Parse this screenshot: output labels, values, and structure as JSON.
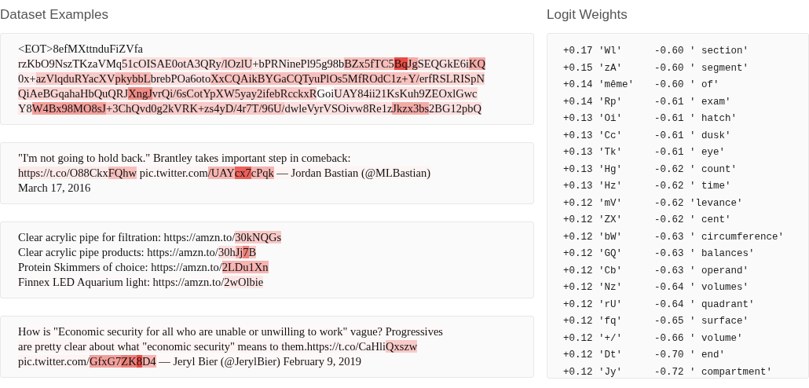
{
  "dataset_examples": {
    "title": "Dataset Examples",
    "examples": [
      {
        "lines": [
          [
            {
              "text": "<EOT>8efMXttnduFiZVfa"
            }
          ],
          [
            {
              "text": "rzKbO9NszTKzaVMq",
              "color": "#fef4f4"
            },
            {
              "text": "51cOISAE0otA3QRy",
              "color": "#fbdfde"
            },
            {
              "text": "/lOzlU",
              "color": "#f9d1cf"
            },
            {
              "text": "+bPRNinePl95g98b",
              "color": "#fceae9"
            },
            {
              "text": "BZx5fTC5",
              "color": "#f7c0bd"
            },
            {
              "text": "Bq",
              "color": "#e84c44"
            },
            {
              "text": "Jg",
              "color": "#f4aba7"
            },
            {
              "text": "SEQGkE6i",
              "color": "#fbdfde"
            },
            {
              "text": "KQ",
              "color": "#f4aba7"
            }
          ],
          [
            {
              "text": "0x+",
              "color": "#fceae9"
            },
            {
              "text": "azVlqduRYacXV",
              "color": "#f8cac8"
            },
            {
              "text": "pkybbL",
              "color": "#f6b5b2"
            },
            {
              "text": "brebPOa6oto",
              "color": "#fbdfde"
            },
            {
              "text": "XxCQAikBYGaCQTyuPlOs5MfROdC1z+Y/",
              "color": "#f7c0bd"
            },
            {
              "text": "erfRSLRISpN",
              "color": "#fad5d3"
            }
          ],
          [
            {
              "text": "QiAeBGqahaHbQuQRJ",
              "color": "#fad5d3"
            },
            {
              "text": "XngJ",
              "color": "#f08b86"
            },
            {
              "text": "vrQi/6sCotYpXW5yay2ifebRcckxR",
              "color": "#f8cac8"
            },
            {
              "text": "Goi",
              "color": "#fefbfb"
            },
            {
              "text": "UAY84ii21KsKuh9ZEOxlGwc",
              "color": "#fbdfde"
            }
          ],
          [
            {
              "text": "Y8",
              "color": "#fceae9"
            },
            {
              "text": "W4Bx98MO8sJ",
              "color": "#f3a09c"
            },
            {
              "text": "+3ChQvd0g2kVRK+zs4yD/4r7T/96U/",
              "color": "#f8cac8"
            },
            {
              "text": "dwleVyrVSOivw8Re1z",
              "color": "#fbdfde"
            },
            {
              "text": "Jkzx3bs",
              "color": "#f4aba7"
            },
            {
              "text": "2BG12pbQ",
              "color": "#fbdfde"
            }
          ]
        ]
      },
      {
        "lines": [
          [
            {
              "text": "\"I'm not going to hold back.\" Brantley takes important step in comeback:",
              "color": "#fef9f8"
            }
          ],
          [
            {
              "text": "https://t.co/O88Ckx",
              "color": "#fceae9"
            },
            {
              "text": "FQhw",
              "color": "#f7c0bd"
            },
            {
              "text": " pic.twitter.com",
              "color": "#fef4f4"
            },
            {
              "text": "/UAY",
              "color": "#f6b5b2"
            },
            {
              "text": "cx7",
              "color": "#eb615a"
            },
            {
              "text": "cPqk",
              "color": "#f6b5b2"
            },
            {
              "text": " — Jordan Bastian (@MLBastian)",
              "color": "#fef4f4"
            }
          ],
          [
            {
              "text": "March 17, 2016"
            }
          ]
        ]
      },
      {
        "lines": [
          [
            {
              "text": "Clear acrylic pipe for filtration: https://amzn.to/"
            },
            {
              "text": "30kNQGs",
              "color": "#f8cac8"
            }
          ],
          [
            {
              "text": "Clear acrylic pipe products: https://amzn.to/"
            },
            {
              "text": "30h",
              "color": "#fbdfde"
            },
            {
              "text": "Jj",
              "color": "#f6b5b2"
            },
            {
              "text": "7",
              "color": "#ef817b"
            },
            {
              "text": "B",
              "color": "#f8cac8"
            }
          ],
          [
            {
              "text": "Protein Skimmers of choice: https://amzn.to/"
            },
            {
              "text": "2LDu1Xn",
              "color": "#f6b5b2"
            }
          ],
          [
            {
              "text": "Finnex LED Aquarium light: https://amzn.to/",
              "color": "#fef9f8"
            },
            {
              "text": "2wOlbie",
              "color": "#fce6e5"
            }
          ]
        ]
      },
      {
        "lines": [
          [
            {
              "text": "How is \"Economic security for all who are unable or unwilling to work\" vague? Progressives",
              "color": "#fef9f8"
            }
          ],
          [
            {
              "text": "are pretty clear about what \"economic security\" means to them.https://t.co/CaHli",
              "color": "#fef4f4"
            },
            {
              "text": "Qxszw",
              "color": "#f8cac8"
            }
          ],
          [
            {
              "text": "pic.twitter.com/",
              "color": "#fef4f4"
            },
            {
              "text": "GfxG7",
              "color": "#f3a09c"
            },
            {
              "text": "ZK",
              "color": "#ef817b"
            },
            {
              "text": "8",
              "color": "#e84c44"
            },
            {
              "text": "D4",
              "color": "#f6b5b2"
            },
            {
              "text": " — Jeryl Bier (@JerylBier) February 9, 2019",
              "color": "#fef9f8"
            }
          ]
        ]
      }
    ]
  },
  "logit_weights": {
    "title": "Logit Weights",
    "rows": [
      {
        "positive_value": "+0.17",
        "positive_token": "'Wl'",
        "negative_value": "-0.60",
        "negative_token": "' section'"
      },
      {
        "positive_value": "+0.15",
        "positive_token": "'zA'",
        "negative_value": "-0.60",
        "negative_token": "' segment'"
      },
      {
        "positive_value": "+0.14",
        "positive_token": "'même'",
        "negative_value": "-0.60",
        "negative_token": "' of'"
      },
      {
        "positive_value": "+0.14",
        "positive_token": "'Rp'",
        "negative_value": "-0.61",
        "negative_token": "' exam'"
      },
      {
        "positive_value": "+0.13",
        "positive_token": "'Oi'",
        "negative_value": "-0.61",
        "negative_token": "' hatch'"
      },
      {
        "positive_value": "+0.13",
        "positive_token": "'Cc'",
        "negative_value": "-0.61",
        "negative_token": "' dusk'"
      },
      {
        "positive_value": "+0.13",
        "positive_token": "'Tk'",
        "negative_value": "-0.61",
        "negative_token": "' eye'"
      },
      {
        "positive_value": "+0.13",
        "positive_token": "'Hg'",
        "negative_value": "-0.62",
        "negative_token": "' count'"
      },
      {
        "positive_value": "+0.13",
        "positive_token": "'Hz'",
        "negative_value": "-0.62",
        "negative_token": "' time'"
      },
      {
        "positive_value": "+0.12",
        "positive_token": "'mV'",
        "negative_value": "-0.62",
        "negative_token": "'levance'"
      },
      {
        "positive_value": "+0.12",
        "positive_token": "'ZX'",
        "negative_value": "-0.62",
        "negative_token": "' cent'"
      },
      {
        "positive_value": "+0.12",
        "positive_token": "'bW'",
        "negative_value": "-0.63",
        "negative_token": "' circumference'"
      },
      {
        "positive_value": "+0.12",
        "positive_token": "'GQ'",
        "negative_value": "-0.63",
        "negative_token": "' balances'"
      },
      {
        "positive_value": "+0.12",
        "positive_token": "'Cb'",
        "negative_value": "-0.63",
        "negative_token": "' operand'"
      },
      {
        "positive_value": "+0.12",
        "positive_token": "'Nz'",
        "negative_value": "-0.64",
        "negative_token": "' volumes'"
      },
      {
        "positive_value": "+0.12",
        "positive_token": "'rU'",
        "negative_value": "-0.64",
        "negative_token": "' quadrant'"
      },
      {
        "positive_value": "+0.12",
        "positive_token": "'fq'",
        "negative_value": "-0.65",
        "negative_token": "' surface'"
      },
      {
        "positive_value": "+0.12",
        "positive_token": "'+/'",
        "negative_value": "-0.66",
        "negative_token": "' volume'"
      },
      {
        "positive_value": "+0.12",
        "positive_token": "'Dt'",
        "negative_value": "-0.70",
        "negative_token": "' end'"
      },
      {
        "positive_value": "+0.12",
        "positive_token": "'Jy'",
        "negative_value": "-0.72",
        "negative_token": "' compartment'"
      }
    ]
  }
}
